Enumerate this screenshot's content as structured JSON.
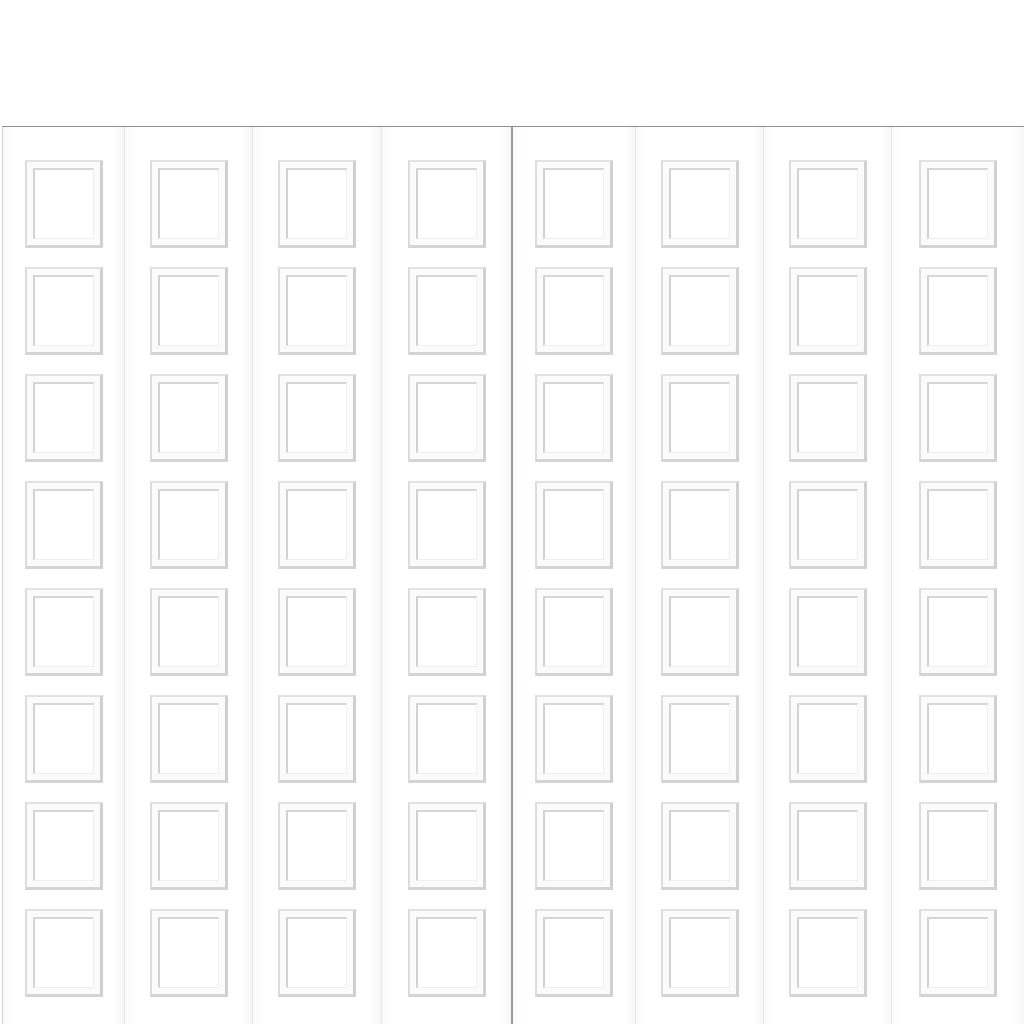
{
  "image": {
    "subject": "white-garage-door",
    "background_color": "#ffffff",
    "door_color": "#ffffff",
    "seam_color": "#9a9a9a",
    "panel_shadow_color": "#d0d0d0"
  },
  "door": {
    "leaves": [
      {
        "slats": 4,
        "panels_per_slat": 8
      },
      {
        "slats": 4,
        "panels_per_slat": 8
      }
    ]
  }
}
